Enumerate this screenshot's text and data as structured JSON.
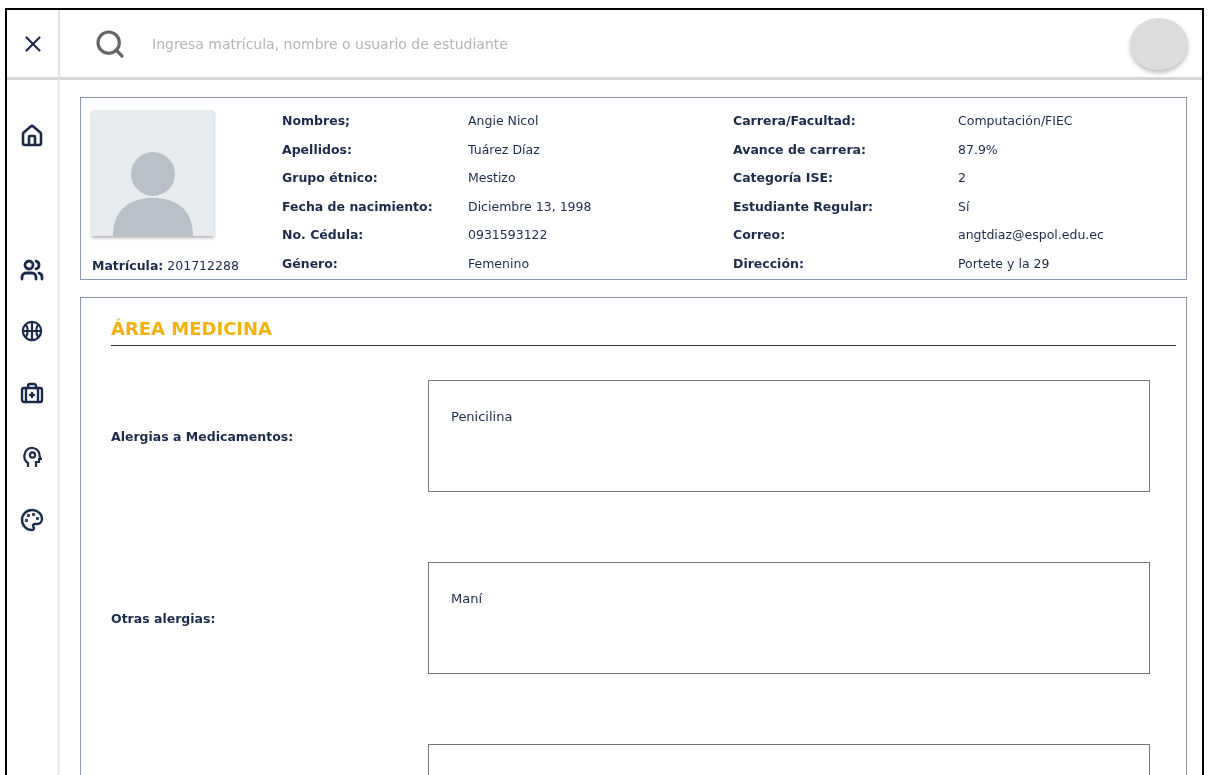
{
  "search": {
    "placeholder": "Ingresa matrícula, nombre o usuario de estudiante"
  },
  "student": {
    "matricula_label": "Matrícula:",
    "matricula": "201712288",
    "left": [
      {
        "label": "Nombres;",
        "value": "Angie Nicol"
      },
      {
        "label": "Apellidos:",
        "value": "Tuárez Díaz"
      },
      {
        "label": "Grupo étnico:",
        "value": "Mestizo"
      },
      {
        "label": "Fecha de nacimiento:",
        "value": "Diciembre 13, 1998"
      },
      {
        "label": "No. Cédula:",
        "value": "0931593122"
      },
      {
        "label": "Género:",
        "value": "Femenino"
      }
    ],
    "right": [
      {
        "label": "Carrera/Facultad:",
        "value": "Computación/FIEC"
      },
      {
        "label": "Avance de carrera:",
        "value": "87.9%"
      },
      {
        "label": "Categoría ISE:",
        "value": "2"
      },
      {
        "label": "Estudiante Regular:",
        "value": "Sí"
      },
      {
        "label": "Correo:",
        "value": "angtdiaz@espol.edu.ec"
      },
      {
        "label": "Dirección:",
        "value": "Portete y la 29"
      }
    ]
  },
  "section": {
    "title": "ÁREA MEDICINA",
    "fields": [
      {
        "kind": "text",
        "label": "Alergias a Medicamentos:",
        "value": "Penicilina"
      },
      {
        "kind": "text",
        "label": "Otras alergias:",
        "value": "Maní"
      },
      {
        "kind": "blank"
      }
    ]
  }
}
